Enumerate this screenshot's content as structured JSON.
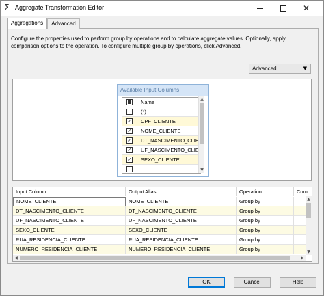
{
  "window": {
    "title": "Aggregate Transformation Editor",
    "app_icon": "sigma-icon"
  },
  "tabs": [
    {
      "label": "Aggregations",
      "active": true
    },
    {
      "label": "Advanced",
      "active": false
    }
  ],
  "description": "Configure the properties used to perform group by operations and to calculate aggregate values. Optionally, apply comparison options to the operation. To configure multiple group by operations, click Advanced.",
  "advanced_dropdown": {
    "label": "Advanced"
  },
  "available_columns": {
    "title": "Available Input Columns",
    "header_label": "Name",
    "items": [
      {
        "label": "(*)",
        "checked": false
      },
      {
        "label": "CPF_CLIENTE",
        "checked": true
      },
      {
        "label": "NOME_CLIENTE",
        "checked": true
      },
      {
        "label": "DT_NASCIMENTO_CLIENTE",
        "checked": true
      },
      {
        "label": "UF_NASCIMENTO_CLIENTE",
        "checked": true
      },
      {
        "label": "SEXO_CLIENTE",
        "checked": true
      },
      {
        "label": "",
        "checked": false
      }
    ]
  },
  "grid": {
    "headers": [
      "Input Column",
      "Output Alias",
      "Operation",
      "Com"
    ],
    "rows": [
      {
        "input": "NOME_CLIENTE",
        "alias": "NOME_CLIENTE",
        "operation": "Group by"
      },
      {
        "input": "DT_NASCIMENTO_CLIENTE",
        "alias": "DT_NASCIMENTO_CLIENTE",
        "operation": "Group by"
      },
      {
        "input": "UF_NASCIMENTO_CLIENTE",
        "alias": "UF_NASCIMENTO_CLIENTE",
        "operation": "Group by"
      },
      {
        "input": "SEXO_CLIENTE",
        "alias": "SEXO_CLIENTE",
        "operation": "Group by"
      },
      {
        "input": "RUA_RESIDENCIA_CLIENTE",
        "alias": "RUA_RESIDENCIA_CLIENTE",
        "operation": "Group by"
      },
      {
        "input": "NUMERO_RESIDENCIA_CLIENTE",
        "alias": "NUMERO_RESIDENCIA_CLIENTE",
        "operation": "Group by"
      }
    ]
  },
  "buttons": {
    "ok": "OK",
    "cancel": "Cancel",
    "help": "Help"
  }
}
